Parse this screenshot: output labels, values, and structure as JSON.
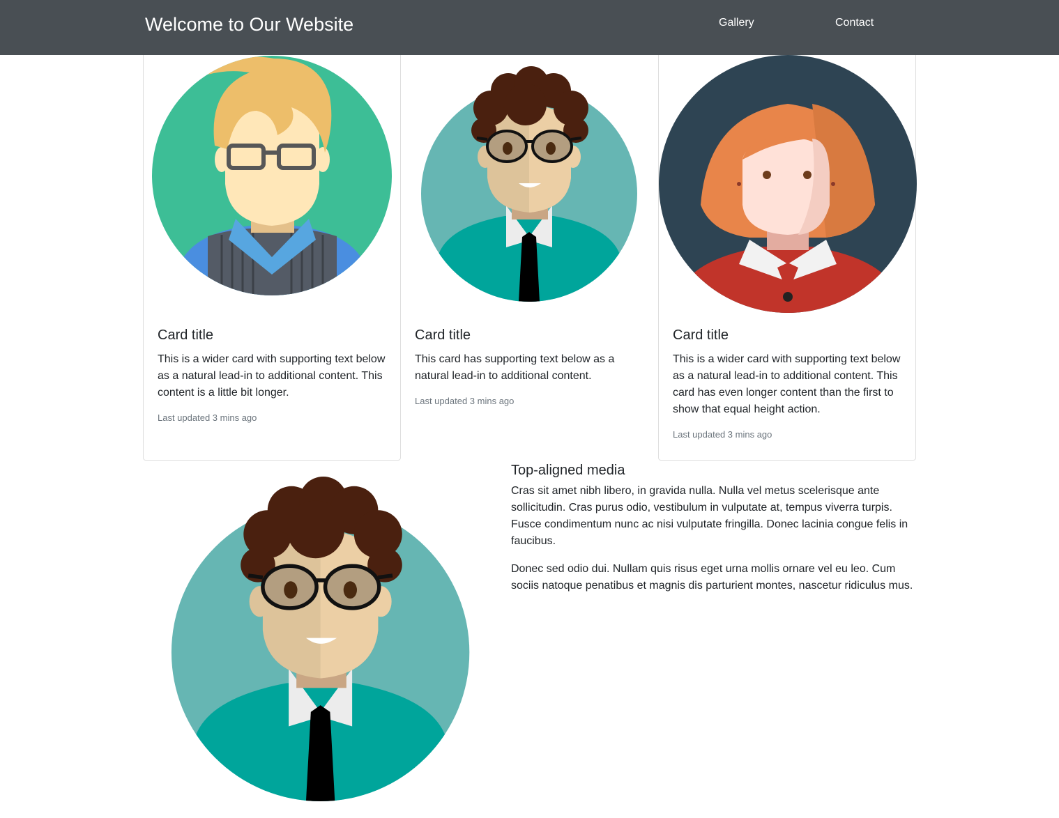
{
  "navbar": {
    "brand": "Welcome to Our Website",
    "links": [
      "Gallery",
      "Contact"
    ]
  },
  "cards": [
    {
      "title": "Card title",
      "text": "This is a wider card with supporting text below as a natural lead-in to additional content. This content is a little bit longer.",
      "meta": "Last updated 3 mins ago"
    },
    {
      "title": "Card title",
      "text": "This card has supporting text below as a natural lead-in to additional content.",
      "meta": "Last updated 3 mins ago"
    },
    {
      "title": "Card title",
      "text": "This is a wider card with supporting text below as a natural lead-in to additional content. This card has even longer content than the first to show that equal height action.",
      "meta": "Last updated 3 mins ago"
    }
  ],
  "media": {
    "heading": "Top-aligned media",
    "paragraphs": [
      "Cras sit amet nibh libero, in gravida nulla. Nulla vel metus scelerisque ante sollicitudin. Cras purus odio, vestibulum in vulputate at, tempus viverra turpis. Fusce condimentum nunc ac nisi vulputate fringilla. Donec lacinia congue felis in faucibus.",
      "Donec sed odio dui. Nullam quis risus eget urna mollis ornare vel eu leo. Cum sociis natoque penatibus et magnis dis parturient montes, nascetur ridiculus mus."
    ]
  },
  "colors": {
    "navbar_bg": "#494f54",
    "avatar1_bg": "#3dbe96",
    "avatar2_bg": "#66b6b3",
    "avatar3_bg": "#2e4453",
    "muted_text": "#6c757d"
  }
}
